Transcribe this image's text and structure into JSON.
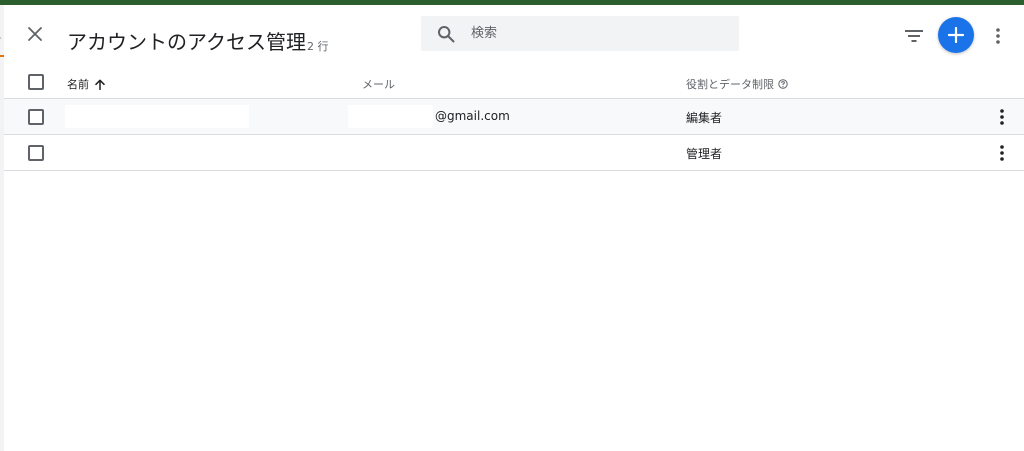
{
  "dialog": {
    "title": "アカウントのアクセス管理",
    "row_count": "2 行"
  },
  "search": {
    "placeholder": "検索",
    "value": ""
  },
  "table": {
    "columns": {
      "name": "名前",
      "email": "メール",
      "role": "役割とデータ制限"
    },
    "rows": [
      {
        "name": "",
        "email": "@gmail.com",
        "role": "編集者"
      },
      {
        "name": "",
        "email": "",
        "role": "管理者"
      }
    ]
  },
  "colors": {
    "accent": "#1a73e8",
    "top_strip": "#2d5f2e",
    "search_bg": "#f1f3f4",
    "divider": "#dadce0"
  },
  "icons": {
    "close": "close-icon",
    "search": "search-icon",
    "filter": "filter-icon",
    "add": "plus-icon",
    "more": "more-vert-icon",
    "sort": "arrow-up-icon",
    "help": "help-icon"
  }
}
